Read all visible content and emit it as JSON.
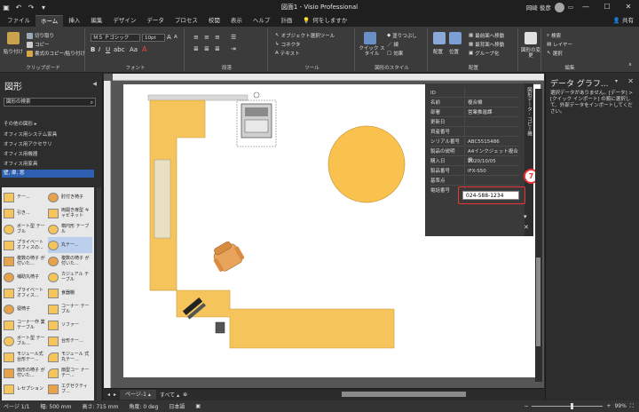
{
  "window": {
    "title": "図面1 - Visio Professional",
    "user": "岡崎 俊彦",
    "share": "共有",
    "tell_me": "何をしますか"
  },
  "tabs": [
    "ファイル",
    "ホーム",
    "挿入",
    "編集",
    "デザイン",
    "データ",
    "プロセス",
    "校閲",
    "表示",
    "ヘルプ",
    "計画"
  ],
  "ribbon": {
    "clipboard": {
      "paste": "貼り付け",
      "cut": "切り取り",
      "copy": "コピー",
      "format_painter": "書式のコピー/貼り付け",
      "label": "クリップボード"
    },
    "font": {
      "font_name": "ＭＳ Ｐゴシック",
      "font_size": "10pt",
      "label": "フォント"
    },
    "paragraph": {
      "label": "段落"
    },
    "tools": {
      "pointer": "オブジェクト選択ツール",
      "connector": "コネクタ",
      "text": "テキスト",
      "label": "ツール"
    },
    "shape_styles": {
      "quick_styles": "クイック スタイル",
      "fill": "塗りつぶし",
      "line": "線",
      "effects": "効果",
      "label": "図形のスタイル"
    },
    "arrange": {
      "align": "配置",
      "position": "位置",
      "bring_forward": "最前面へ移動",
      "send_backward": "最背面へ移動",
      "group": "グループ化",
      "label": "配置"
    },
    "change_shape": "図形の変更",
    "editing": {
      "find": "検索",
      "layers": "レイヤー",
      "select": "選択",
      "label": "編集"
    }
  },
  "shapes_panel": {
    "title": "図形",
    "search_label": "図形の検索",
    "more_shapes": "その他の図形",
    "stencils": [
      "オフィス用システム家具",
      "オフィス用アクセサリ",
      "オフィス用機器",
      "オフィス用家具",
      "壁, 扉, 窓"
    ],
    "shapes": [
      {
        "left": "テー...",
        "right": "肘付き椅子"
      },
      {
        "left": "引き...",
        "right": "両開き扉型 キャビネット"
      },
      {
        "left": "ボート型 テーブル",
        "right": "楕円形 テーブル"
      },
      {
        "left": "プライベート オフィスの...",
        "right": "丸テー..."
      },
      {
        "left": "複数の椅子 が付いた...",
        "right": "複数の椅子 が付いた..."
      },
      {
        "left": "補助丸椅子",
        "right": "カジュアル テーブル"
      },
      {
        "left": "プライベート オフィス...",
        "right": "食器棚"
      },
      {
        "left": "寝椅子",
        "right": "コーナー テーブル"
      },
      {
        "left": "コーナー作 業テーブル",
        "right": "ソファー"
      },
      {
        "left": "ボート型 テーブル...",
        "right": "台形テー..."
      },
      {
        "left": "モジュール式 台形テー...",
        "right": "モジュール 式丸テー..."
      },
      {
        "left": "扇形の椅子 が付いた...",
        "right": "扇型コー ナーテー..."
      },
      {
        "left": "レセプション",
        "right": "エグゼクティ ブ..."
      }
    ]
  },
  "shape_data": {
    "tab_label": "図形データ - コピー機",
    "rows": [
      {
        "key": "ID",
        "value": ""
      },
      {
        "key": "名前",
        "value": "複合機"
      },
      {
        "key": "部署",
        "value": "営業推進課"
      },
      {
        "key": "更新日",
        "value": ""
      },
      {
        "key": "資産番号",
        "value": ""
      },
      {
        "key": "シリアル番号",
        "value": "ABC5515486"
      },
      {
        "key": "製品の説明",
        "value": "A4インクジェット複合機"
      },
      {
        "key": "購入日",
        "value": "2020/10/05"
      },
      {
        "key": "製品番号",
        "value": "IFX-S50"
      },
      {
        "key": "基準点",
        "value": ""
      },
      {
        "key": "電話番号",
        "value": ""
      }
    ],
    "phone_value": "024-588-1234",
    "callout": "7"
  },
  "data_graphics": {
    "title": "データ グラフ...",
    "message": "選択データがありません。[データ] > [クイック インポート] の順に選択して、外部データをインポートしてください。"
  },
  "pages": {
    "page_tab": "ページ-1",
    "all": "すべて"
  },
  "status": {
    "page": "ページ 1/1",
    "width": "幅: 500 mm",
    "height": "高さ: 715 mm",
    "angle": "角度: 0 deg",
    "language": "日本語",
    "zoom": "99%"
  },
  "colors": {
    "desk": "#f5c45a",
    "accent": "#2d5fb0",
    "callout": "#e33333",
    "table": "#f9c24f"
  }
}
